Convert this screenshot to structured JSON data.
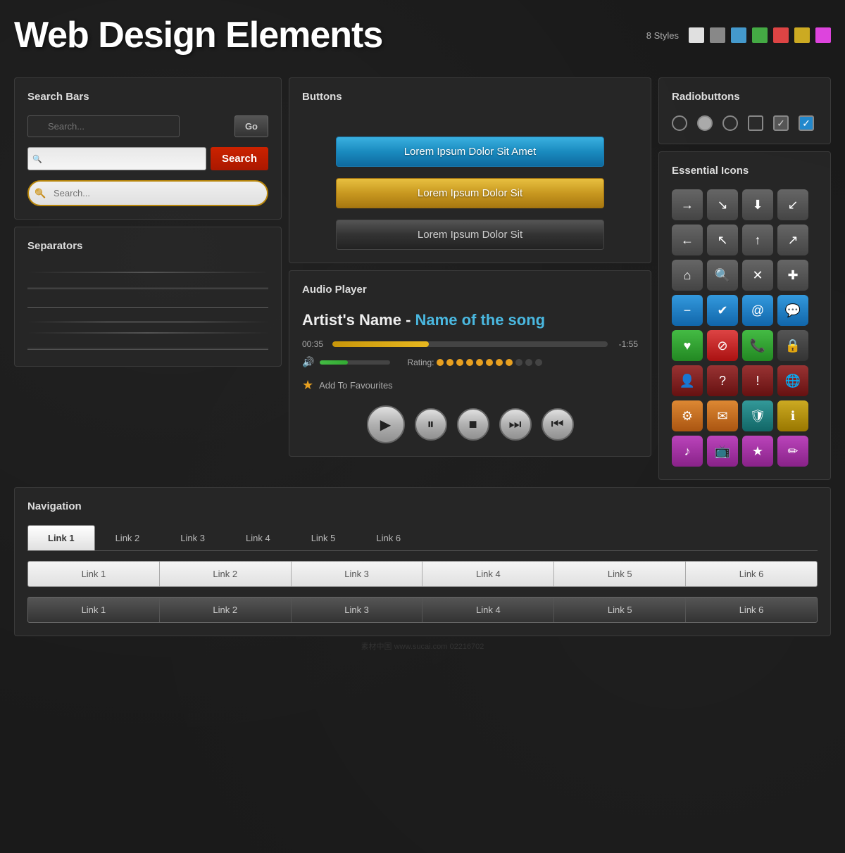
{
  "header": {
    "title": "Web Design Elements",
    "styles_label": "8 Styles",
    "swatches": [
      "#e0e0e0",
      "#888888",
      "#4499cc",
      "#44aa44",
      "#dd4444",
      "#ccaa22",
      "#dd44dd"
    ]
  },
  "search_bars": {
    "title": "Search Bars",
    "bar1": {
      "placeholder": "Search...",
      "button": "Go"
    },
    "bar2": {
      "placeholder": "",
      "button": "Search"
    },
    "bar3": {
      "placeholder": "Search..."
    }
  },
  "buttons": {
    "title": "Buttons",
    "btn1": "Lorem Ipsum Dolor Sit Amet",
    "btn2": "Lorem Ipsum Dolor Sit",
    "btn3": "Lorem Ipsum Dolor Sit"
  },
  "radiobuttons": {
    "title": "Radiobuttons"
  },
  "separators": {
    "title": "Separators"
  },
  "audio_player": {
    "title": "Audio Player",
    "artist": "Artist's Name",
    "dash": " - ",
    "song": "Name of the song",
    "time_current": "00:35",
    "time_remaining": "-1:55",
    "progress_percent": 35,
    "volume_percent": 40,
    "rating_label": "Rating:",
    "rating_filled": 8,
    "rating_total": 11,
    "fav_label": "Add To Favourites",
    "controls": {
      "play": "▶",
      "pause": "⏸",
      "stop": "■",
      "forward": "⏭",
      "backward": "⏮"
    }
  },
  "essential_icons": {
    "title": "Essential Icons",
    "icons": [
      {
        "symbol": "→",
        "color": "gray"
      },
      {
        "symbol": "↘",
        "color": "gray"
      },
      {
        "symbol": "⬇",
        "color": "gray"
      },
      {
        "symbol": "↙",
        "color": "gray"
      },
      {
        "symbol": "←",
        "color": "gray"
      },
      {
        "symbol": "↖",
        "color": "gray"
      },
      {
        "symbol": "↑",
        "color": "gray"
      },
      {
        "symbol": "↗",
        "color": "gray"
      },
      {
        "symbol": "⌂",
        "color": "gray"
      },
      {
        "symbol": "🔍",
        "color": "gray"
      },
      {
        "symbol": "✕",
        "color": "gray"
      },
      {
        "symbol": "✚",
        "color": "gray"
      },
      {
        "symbol": "−",
        "color": "blue"
      },
      {
        "symbol": "✔",
        "color": "blue"
      },
      {
        "symbol": "@",
        "color": "blue"
      },
      {
        "symbol": "💬",
        "color": "blue"
      },
      {
        "symbol": "♥",
        "color": "green"
      },
      {
        "symbol": "⊘",
        "color": "red"
      },
      {
        "symbol": "☎",
        "color": "green"
      },
      {
        "symbol": "🔒",
        "color": "gray"
      },
      {
        "symbol": "👤",
        "color": "maroon"
      },
      {
        "symbol": "?",
        "color": "maroon"
      },
      {
        "symbol": "!",
        "color": "maroon"
      },
      {
        "symbol": "🌐",
        "color": "maroon"
      },
      {
        "symbol": "⚙",
        "color": "orange"
      },
      {
        "symbol": "✉",
        "color": "orange"
      },
      {
        "symbol": "🛡",
        "color": "teal"
      },
      {
        "symbol": "ℹ",
        "color": "yellow"
      },
      {
        "symbol": "♪",
        "color": "pink"
      },
      {
        "symbol": "📺",
        "color": "pink"
      },
      {
        "symbol": "★",
        "color": "pink"
      },
      {
        "symbol": "✏",
        "color": "pink"
      }
    ]
  },
  "navigation": {
    "title": "Navigation",
    "tabs": [
      "Link 1",
      "Link 2",
      "Link 3",
      "Link 4",
      "Link 5",
      "Link 6"
    ],
    "active_tab": 0
  },
  "watermark": "素材中国 www.sucai.com 02216702"
}
